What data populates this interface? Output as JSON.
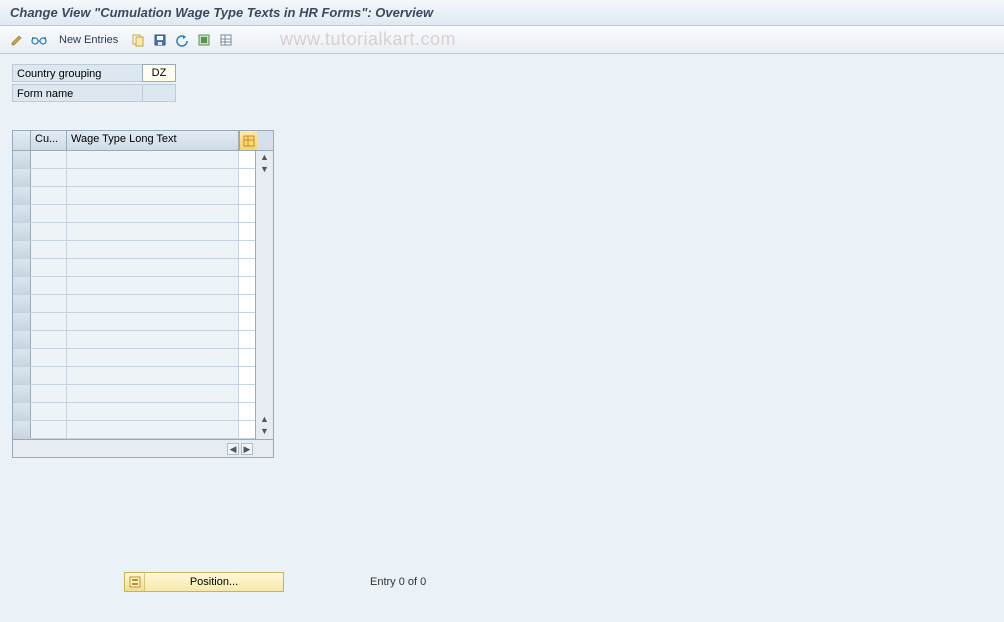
{
  "title": "Change View \"Cumulation Wage Type Texts in HR Forms\": Overview",
  "toolbar": {
    "new_entries_label": "New Entries"
  },
  "watermark": "www.tutorialkart.com",
  "form": {
    "country_grouping_label": "Country grouping",
    "country_grouping_value": "DZ",
    "form_name_label": "Form name",
    "form_name_value": ""
  },
  "grid": {
    "columns": {
      "c1_label": "Cu...",
      "c2_label": "Wage Type Long Text"
    },
    "row_count": 16
  },
  "position_button_label": "Position...",
  "entry_status": "Entry 0 of 0"
}
